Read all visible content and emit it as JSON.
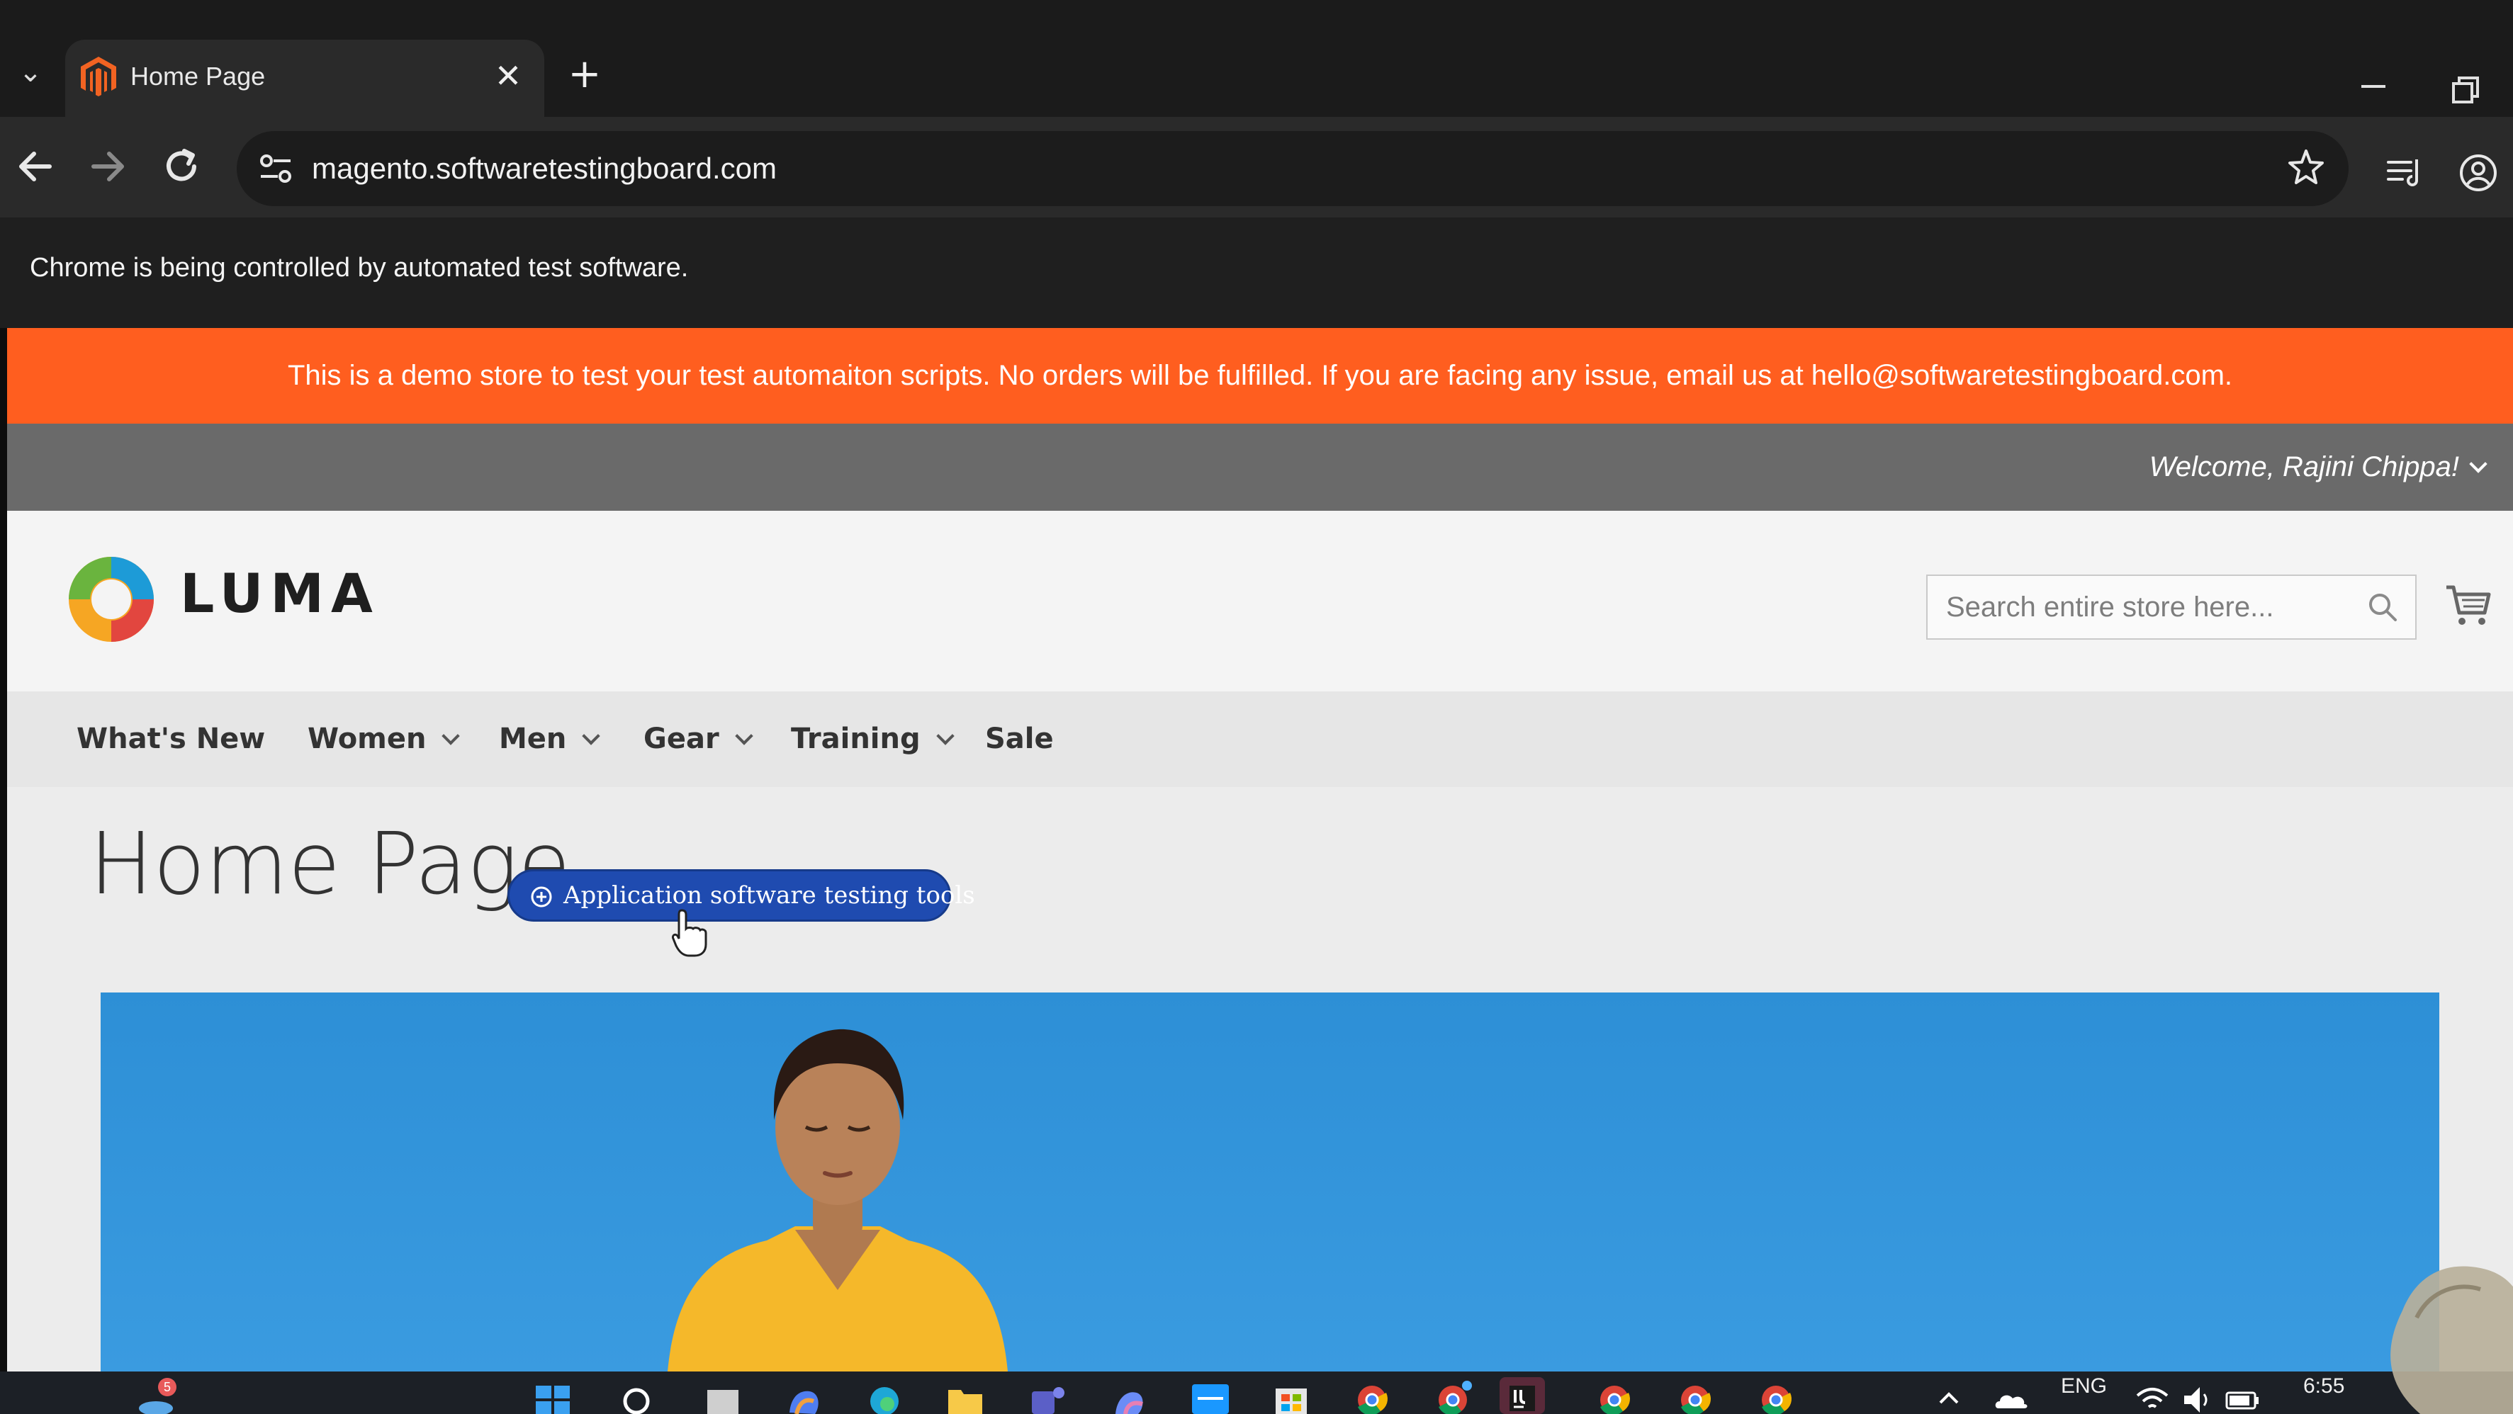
{
  "browser": {
    "tab_title": "Home Page",
    "close_glyph": "✕",
    "new_tab_glyph": "+",
    "url": "magento.softwaretestingboard.com",
    "automation_notice": "Chrome is being controlled by automated test software."
  },
  "store": {
    "demo_notice": "This is a demo store to test your test automaiton scripts. No orders will be fulfilled. If you are facing any issue, email us at hello@softwaretestingboard.com.",
    "welcome": "Welcome, Rajini Chippa!",
    "logo_text": "LUMA",
    "search_placeholder": "Search entire store here...",
    "nav": [
      {
        "label": "What's New",
        "has_menu": false
      },
      {
        "label": "Women",
        "has_menu": true
      },
      {
        "label": "Men",
        "has_menu": true
      },
      {
        "label": "Gear",
        "has_menu": true
      },
      {
        "label": "Training",
        "has_menu": true
      },
      {
        "label": "Sale",
        "has_menu": false
      }
    ],
    "page_title": "Home Page",
    "ad_pill": "Application software testing tools"
  },
  "taskbar": {
    "notification_count": "5",
    "language": "ENG",
    "time": "6:55"
  },
  "colors": {
    "demo_banner": "#ff5e1f",
    "panel_bar": "#6a6a6a",
    "pill": "#1f4bb0",
    "hero_sky": "#2d8fd6"
  }
}
